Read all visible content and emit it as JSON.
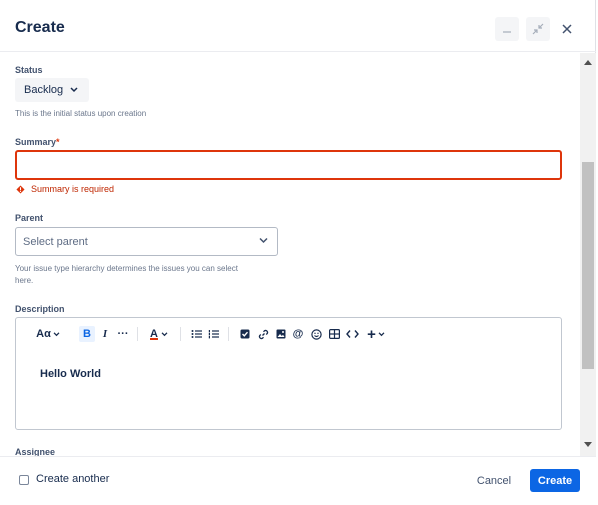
{
  "dialog": {
    "title": "Create"
  },
  "status": {
    "label": "Status",
    "value": "Backlog",
    "help": "This is the initial status upon creation"
  },
  "summary": {
    "label": "Summary",
    "required_mark": "*",
    "value": "",
    "error": "Summary is required"
  },
  "parent": {
    "label": "Parent",
    "placeholder": "Select parent",
    "help_line1": "Your issue type hierarchy determines the issues you can select",
    "help_line2": "here."
  },
  "description": {
    "label": "Description",
    "toolbar": {
      "text_style": "Aα",
      "bold": "B",
      "italic": "I",
      "more": "···",
      "text_color": "A",
      "plus": "+"
    },
    "content": "Hello World"
  },
  "assignee": {
    "label": "Assignee"
  },
  "footer": {
    "create_another_label": "Create another",
    "cancel_label": "Cancel",
    "create_label": "Create"
  },
  "colors": {
    "accent": "#0c66e4",
    "error": "#de350b",
    "text": "#172b4d"
  }
}
